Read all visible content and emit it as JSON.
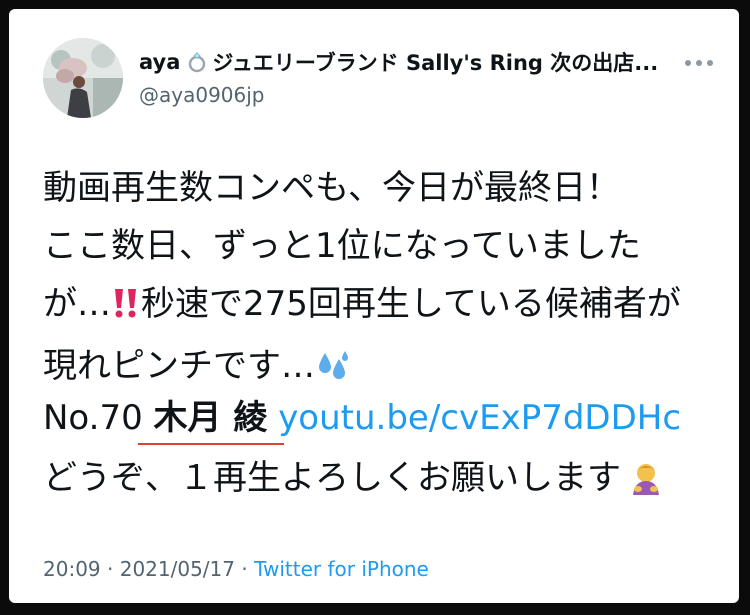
{
  "author": {
    "name": "aya",
    "name_suffix": "ジュエリーブランド Sally's Ring 次の出店...",
    "handle": "@aya0906jp",
    "avatar_icon": "profile-photo",
    "ring_icon": "ring-icon"
  },
  "more_icon": "more-dots-icon",
  "tweet": {
    "lines": [
      "動画再生数コンペも、今日が最終日！",
      "ここ数日、ずっと1位になっていました",
      "が…",
      "秒速で275回再生している候補者が",
      "現れピンチです…"
    ],
    "ref_number": "No.70",
    "candidate_name": "木月 綾",
    "link": "youtu.be/cvExP7dDDHc",
    "outro": "どうぞ、１再生よろしくお願いします"
  },
  "icons": {
    "double_exclamation": "double-exclamation-icon",
    "sweat_droplets": "sweat-droplets-icon",
    "bowing_person": "bowing-person-icon"
  },
  "meta": {
    "time": "20:09",
    "separator": "·",
    "date": "2021/05/17",
    "source": "Twitter for iPhone"
  },
  "colors": {
    "link": "#1d9bf0",
    "text": "#0f1419",
    "muted": "#536471",
    "highlight_underline": "#d6452c"
  }
}
